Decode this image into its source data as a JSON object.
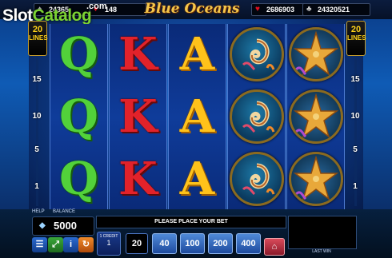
{
  "header": {
    "title": "Blue Oceans",
    "watermark_slot": "Slot",
    "watermark_catalog": "Catalog",
    "watermark_sub": ".com",
    "jackpots": [
      {
        "suit": "spade",
        "symbol": "♠",
        "value": "24365"
      },
      {
        "suit": "diamond",
        "symbol": "♦",
        "value": "148"
      },
      {
        "suit": "heart",
        "symbol": "♥",
        "value": "2686903"
      },
      {
        "suit": "club",
        "symbol": "♣",
        "value": "24320521"
      }
    ]
  },
  "lines": {
    "count": "20",
    "label": "LINES",
    "markers": [
      "15",
      "10",
      "5",
      "1"
    ]
  },
  "reels": [
    [
      "Q",
      "Q",
      "Q"
    ],
    [
      "K",
      "K",
      "K"
    ],
    [
      "A",
      "A",
      "A"
    ],
    [
      "nautilus",
      "nautilus",
      "nautilus"
    ],
    [
      "starfish",
      "starfish",
      "starfish"
    ]
  ],
  "panel": {
    "help_label": "HELP",
    "balance_label": "BALANCE",
    "balance": "5000",
    "message": "PLEASE PLACE YOUR BET",
    "credit_label": "1 CREDIT",
    "credit_value": "1",
    "bet_selected": "20",
    "bets": [
      "40",
      "100",
      "200",
      "400"
    ],
    "last_win_label": "LAST WIN"
  },
  "colors": {
    "q": "#52d13a",
    "k": "#e2222a",
    "a": "#ffc21a",
    "accent_gold": "#ffd21a"
  }
}
